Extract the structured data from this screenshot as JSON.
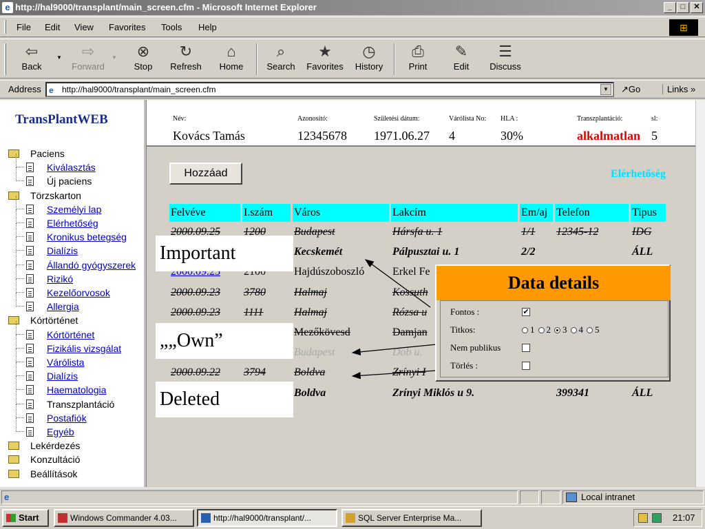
{
  "window": {
    "title": "http://hal9000/transplant/main_screen.cfm - Microsoft Internet Explorer",
    "min": "_",
    "max": "□",
    "close": "✕"
  },
  "menu": [
    "File",
    "Edit",
    "View",
    "Favorites",
    "Tools",
    "Help"
  ],
  "toolbar": {
    "back": "Back",
    "forward": "Forward",
    "stop": "Stop",
    "refresh": "Refresh",
    "home": "Home",
    "search": "Search",
    "favorites": "Favorites",
    "history": "History",
    "print": "Print",
    "edit": "Edit",
    "discuss": "Discuss"
  },
  "address": {
    "label": "Address",
    "url": "http://hal9000/transplant/main_screen.cfm",
    "go": "Go",
    "links": "Links »"
  },
  "sidebar": {
    "logo": "TransPlantWEB",
    "items": [
      {
        "label": "Paciens",
        "type": "folder",
        "link": false
      },
      {
        "label": "Kiválasztás",
        "type": "doc",
        "link": true
      },
      {
        "label": "Új paciens",
        "type": "doc",
        "link": false
      },
      {
        "label": "Törzskarton",
        "type": "folder",
        "link": false
      },
      {
        "label": "Személyi lap",
        "type": "doc",
        "link": true
      },
      {
        "label": "Elérhetőség",
        "type": "doc",
        "link": true
      },
      {
        "label": "Kronikus betegség",
        "type": "doc",
        "link": true
      },
      {
        "label": "Dialízis",
        "type": "doc",
        "link": true
      },
      {
        "label": "Állandó gyógyszerek",
        "type": "doc",
        "link": true
      },
      {
        "label": "Rizikó",
        "type": "doc",
        "link": true
      },
      {
        "label": "Kezelőorvosok",
        "type": "doc",
        "link": true
      },
      {
        "label": "Allergia",
        "type": "doc",
        "link": true
      },
      {
        "label": "Kórtörténet",
        "type": "folder",
        "link": false
      },
      {
        "label": "Kórtörténet",
        "type": "doc",
        "link": true
      },
      {
        "label": "Fizikális vizsgálat",
        "type": "doc",
        "link": true
      },
      {
        "label": "Várólista",
        "type": "doc",
        "link": true
      },
      {
        "label": "Dialízis",
        "type": "doc",
        "link": true
      },
      {
        "label": "Haematologia",
        "type": "doc",
        "link": true
      },
      {
        "label": "Transzplantáció",
        "type": "doc",
        "link": false
      },
      {
        "label": "Postafiók",
        "type": "doc",
        "link": true
      },
      {
        "label": "Egyéb",
        "type": "doc",
        "link": true
      },
      {
        "label": "Lekérdezés",
        "type": "folder",
        "link": false
      },
      {
        "label": "Konzultáció",
        "type": "folder",
        "link": false
      },
      {
        "label": "Beállítások",
        "type": "folder",
        "link": false
      }
    ]
  },
  "header": {
    "name_label": "Név:",
    "name": "Kovács Tamás",
    "id_label": "Azonosító:",
    "id": "12345678",
    "dob_label": "Születési dátum:",
    "dob": "1971.06.27",
    "waitlist_label": "Várólista No:",
    "waitlist": "4",
    "hla_label": "HLA :",
    "hla": "30%",
    "transplant_label": "Transzplantáció:",
    "transplant": "alkalmatlan",
    "sl_label": "sl:",
    "sl": "5"
  },
  "main": {
    "add_button": "Hozzáad",
    "reach_link": "Elérhetőség",
    "columns": [
      "Felvéve",
      "I.szám",
      "Város",
      "Lakcím",
      "Em/aj",
      "Telefon",
      "Tipus"
    ],
    "rows": [
      {
        "style": "del",
        "cells": [
          "2000.09.25",
          "1200",
          "Budapest",
          "Hársfa u. 1",
          "1/1",
          "12345-12",
          "IDG"
        ]
      },
      {
        "style": "bold",
        "cells": [
          "",
          "",
          "Kecskemét",
          "Pálpusztai u. 1",
          "2/2",
          "",
          "ÁLL"
        ]
      },
      {
        "style": "link",
        "cells": [
          "2000.09.23",
          "2100",
          "Hajdúszoboszló",
          "Erkel Fe",
          "",
          "",
          ""
        ]
      },
      {
        "style": "del",
        "cells": [
          "2000.09.23",
          "3780",
          "Halmaj",
          "Kossuth",
          "",
          "",
          ""
        ]
      },
      {
        "style": "del",
        "cells": [
          "2000.09.23",
          "1111",
          "Halmaj",
          "Rózsa u",
          "",
          "",
          ""
        ]
      },
      {
        "style": "delplain",
        "cells": [
          "",
          "",
          "Mezőkövesd",
          "Damjan",
          "",
          "",
          ""
        ]
      },
      {
        "style": "grey",
        "cells": [
          "",
          "",
          "Budapest",
          "Dob u.",
          "",
          "",
          ""
        ]
      },
      {
        "style": "del",
        "cells": [
          "2000.09.22",
          "3794",
          "Boldva",
          "Zrínyi I",
          "",
          "",
          ""
        ]
      },
      {
        "style": "bold",
        "cells": [
          "",
          "",
          "Boldva",
          "Zrínyi Miklós u 9.",
          "",
          "399341",
          "ÁLL"
        ]
      }
    ]
  },
  "callouts": {
    "important": "Important",
    "own": "„„Own”",
    "deleted": "Deleted"
  },
  "details": {
    "title": "Data details",
    "fontos_label": "Fontos :",
    "fontos_checked": true,
    "titkos_label": "Titkos:",
    "titkos_options": [
      "1",
      "2",
      "3",
      "4",
      "5"
    ],
    "titkos_selected": "3",
    "nempub_label": "Nem publikus",
    "nempub_checked": false,
    "torles_label": "Törlés :",
    "torles_checked": false
  },
  "status": {
    "zone": "Local intranet"
  },
  "taskbar": {
    "start": "Start",
    "tasks": [
      "Windows Commander 4.03...",
      "http://hal9000/transplant/...",
      "SQL Server Enterprise Ma..."
    ],
    "active_task": 1,
    "clock": "21:07"
  }
}
